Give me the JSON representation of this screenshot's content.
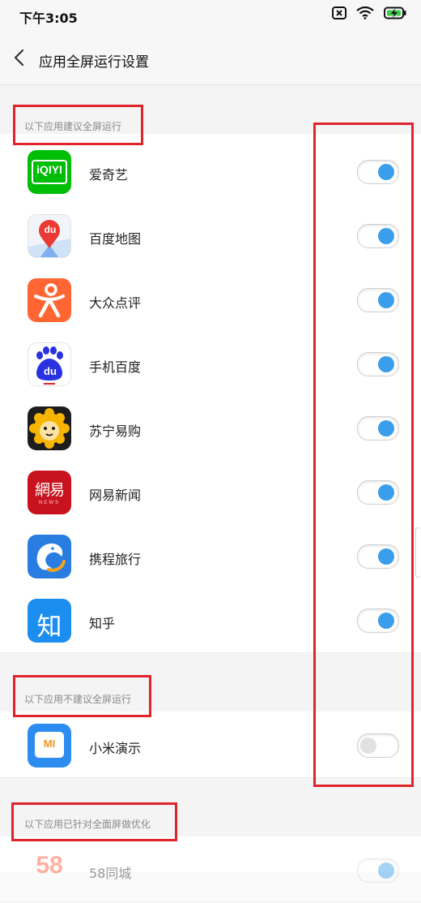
{
  "status_bar": {
    "time": "下午3:05"
  },
  "header": {
    "title": "应用全屏运行设置"
  },
  "sections": {
    "recommended": {
      "label": "以下应用建议全屏运行",
      "apps": [
        {
          "name": "爱奇艺",
          "icon": "iqiyi-app-icon",
          "enabled": true
        },
        {
          "name": "百度地图",
          "icon": "baidu-map-app-icon",
          "enabled": true
        },
        {
          "name": "大众点评",
          "icon": "dianping-app-icon",
          "enabled": true
        },
        {
          "name": "手机百度",
          "icon": "baidu-app-icon",
          "enabled": true
        },
        {
          "name": "苏宁易购",
          "icon": "suning-app-icon",
          "enabled": true
        },
        {
          "name": "网易新闻",
          "icon": "netease-news-app-icon",
          "enabled": true
        },
        {
          "name": "携程旅行",
          "icon": "ctrip-app-icon",
          "enabled": true
        },
        {
          "name": "知乎",
          "icon": "zhihu-app-icon",
          "enabled": true
        }
      ]
    },
    "not_recommended": {
      "label": "以下应用不建议全屏运行",
      "apps": [
        {
          "name": "小米演示",
          "icon": "mi-presentation-app-icon",
          "enabled": false
        }
      ]
    },
    "optimized": {
      "label": "以下应用已针对全面屏做优化",
      "apps": [
        {
          "name": "58同城",
          "icon": "58-app-icon",
          "enabled": true
        }
      ]
    }
  },
  "icon_text": {
    "iqiyi": "iQIYI",
    "baidu_map": "du",
    "baidu": "du",
    "netease_top": "網易",
    "netease_bottom": "NEWS",
    "zhihu": "知",
    "mi": "MI",
    "fiftyeight": "58"
  },
  "colors": {
    "accent": "#3a9eea",
    "highlight": "#e0242c",
    "iqiyi_green": "#00be06",
    "dianping_orange": "#ff6633",
    "netease_red": "#c8121e",
    "ctrip_blue": "#2a7de0",
    "zhihu_blue": "#1b8ef0",
    "mi_blue": "#2d8cf0"
  }
}
